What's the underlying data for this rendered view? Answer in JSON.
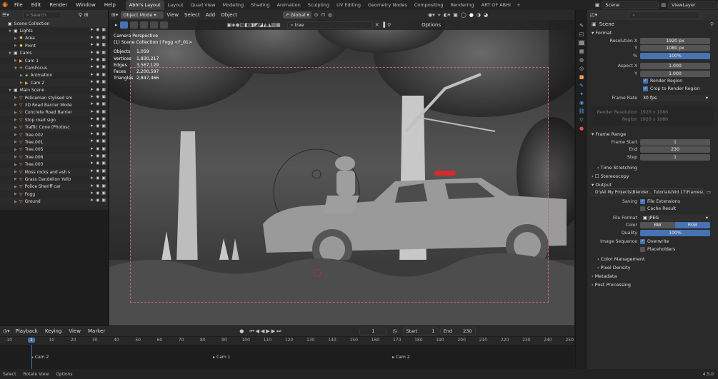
{
  "topbar": {
    "menu": [
      "File",
      "Edit",
      "Render",
      "Window",
      "Help"
    ],
    "workspaces": [
      "Abhi's Layout",
      "Layout",
      "Quad View",
      "Modeling",
      "Shading",
      "Animation",
      "Sculpting",
      "UV Editing",
      "Geometry Nodes",
      "Compositing",
      "Rendering",
      "ART OF ABHI"
    ],
    "active_workspace": "Abhi's Layout",
    "scene": "Scene",
    "view_layer": "ViewLayer"
  },
  "outliner": {
    "search_placeholder": "Search",
    "rows": [
      {
        "label": "Scene Collection",
        "indent": 0,
        "icon": "collection",
        "tri": ""
      },
      {
        "label": "Lights",
        "indent": 1,
        "icon": "collection",
        "tri": "v"
      },
      {
        "label": "Area",
        "indent": 2,
        "icon": "light",
        "tri": ">"
      },
      {
        "label": "Point",
        "indent": 2,
        "icon": "light",
        "tri": ">"
      },
      {
        "label": "Cams",
        "indent": 1,
        "icon": "collection",
        "tri": "v"
      },
      {
        "label": "Cam 1",
        "indent": 2,
        "icon": "camera",
        "tri": ">"
      },
      {
        "label": "CamFocus",
        "indent": 2,
        "icon": "empty",
        "tri": "v"
      },
      {
        "label": "Animation",
        "indent": 3,
        "icon": "anim",
        "tri": ">"
      },
      {
        "label": "Cam 2",
        "indent": 3,
        "icon": "camera",
        "tri": ">"
      },
      {
        "label": "Main Scene",
        "indent": 1,
        "icon": "collection",
        "tri": "v"
      },
      {
        "label": "Policeman stylised sm",
        "indent": 2,
        "icon": "mesh",
        "tri": ">"
      },
      {
        "label": "3D Road Barrier Mode",
        "indent": 2,
        "icon": "mesh",
        "tri": ">"
      },
      {
        "label": "Concrete Road Barrier",
        "indent": 2,
        "icon": "mesh",
        "tri": ">"
      },
      {
        "label": "Stop road sign",
        "indent": 2,
        "icon": "mesh",
        "tri": ">"
      },
      {
        "label": "Traffic Cone (Photosc",
        "indent": 2,
        "icon": "mesh",
        "tri": ">"
      },
      {
        "label": "Tree.002",
        "indent": 2,
        "icon": "mesh",
        "tri": ">"
      },
      {
        "label": "Tree.001",
        "indent": 2,
        "icon": "mesh",
        "tri": ">"
      },
      {
        "label": "Tree.005",
        "indent": 2,
        "icon": "mesh",
        "tri": ">"
      },
      {
        "label": "Tree.006",
        "indent": 2,
        "icon": "mesh",
        "tri": ">"
      },
      {
        "label": "Tree.003",
        "indent": 2,
        "icon": "mesh",
        "tri": ">"
      },
      {
        "label": "Moss rocks and ash s",
        "indent": 2,
        "icon": "mesh",
        "tri": ">"
      },
      {
        "label": "Grass Dandelion Yello",
        "indent": 2,
        "icon": "mesh",
        "tri": ">"
      },
      {
        "label": "Police Sheriff car",
        "indent": 2,
        "icon": "mesh",
        "tri": ">"
      },
      {
        "label": "Fogg",
        "indent": 2,
        "icon": "mesh",
        "tri": ">"
      },
      {
        "label": "Ground",
        "indent": 2,
        "icon": "mesh",
        "tri": ">"
      }
    ]
  },
  "viewport": {
    "mode": "Object Mode",
    "menus": [
      "View",
      "Select",
      "Add",
      "Object"
    ],
    "transform": "Global",
    "search_value": "tree",
    "options": "Options",
    "overlay_title": "Camera Perspective",
    "overlay_path": "(1) Scene Collection | Fogg <F_01>",
    "stats": [
      {
        "k": "Objects",
        "v": "1,059"
      },
      {
        "k": "Vertices",
        "v": "1,830,217"
      },
      {
        "k": "Edges",
        "v": "3,567,129"
      },
      {
        "k": "Faces",
        "v": "2,200,597"
      },
      {
        "k": "Triangles",
        "v": "2,847,466"
      }
    ]
  },
  "properties": {
    "format_label": "Format",
    "rows_format": [
      {
        "label": "Resolution X",
        "value": "1920 px",
        "style": ""
      },
      {
        "label": "Y",
        "value": "1080 px",
        "style": ""
      },
      {
        "label": "%",
        "value": "100%",
        "style": "blue"
      },
      {
        "label": "Aspect X",
        "value": "1.000",
        "style": ""
      },
      {
        "label": "Y",
        "value": "1.000",
        "style": ""
      }
    ],
    "render_region": "Render Region",
    "crop_region": "Crop to Render Region",
    "frame_rate_label": "Frame Rate",
    "frame_rate": "30 fps",
    "render_resolution_label": "Render Resolution",
    "render_resolution": "1920 x 1080",
    "region_label": "Region",
    "region": "1920 x 1080",
    "frame_range_label": "Frame Range",
    "rows_range": [
      {
        "label": "Frame Start",
        "value": "1"
      },
      {
        "label": "End",
        "value": "230"
      },
      {
        "label": "Step",
        "value": "1"
      }
    ],
    "time_stretching": "Time Stretching",
    "stereoscopy": "Stereoscopy",
    "output_label": "Output",
    "output_path": "D:\\All My Projects\\Blender... Tutorials\\Vid 17\\Frames\\",
    "saving_label": "Saving",
    "file_extensions": "File Extensions",
    "cache_result": "Cache Result",
    "file_format_label": "File Format",
    "file_format": "JPEG",
    "color_label": "Color",
    "color_bw": "BW",
    "color_rgb": "RGB",
    "quality_label": "Quality",
    "quality": "100%",
    "image_sequence_label": "Image Sequence",
    "overwrite": "Overwrite",
    "placeholders": "Placeholders",
    "color_management": "Color Management",
    "pixel_density": "Pixel Density",
    "metadata": "Metadata",
    "post_processing": "Post Processing"
  },
  "timeline": {
    "menus": [
      "Playback",
      "Keying",
      "View",
      "Marker"
    ],
    "current_frame": "1",
    "start_label": "Start",
    "start": "1",
    "end_label": "End",
    "end": "230",
    "ticks": [
      "-10",
      "1",
      "10",
      "20",
      "30",
      "40",
      "50",
      "60",
      "70",
      "80",
      "90",
      "100",
      "110",
      "120",
      "130",
      "140",
      "150",
      "160",
      "170",
      "180",
      "190",
      "200",
      "210",
      "220",
      "230",
      "240",
      "250"
    ],
    "markers": [
      {
        "label": "Cam 2",
        "frame": 1
      },
      {
        "label": "Cam 1",
        "frame": 85
      },
      {
        "label": "Cam 2",
        "frame": 168
      }
    ]
  },
  "status": {
    "items": [
      "Select",
      "Rotate View",
      "Options"
    ],
    "version": "4.5.0"
  },
  "colors": {
    "accent": "#4772b3",
    "object_orange": "#ff9f45",
    "light_yellow": "#ffd24a",
    "data_green": "#6ed86e",
    "camera_frame": "#b96a6a",
    "police_light": "#d42a2a"
  }
}
